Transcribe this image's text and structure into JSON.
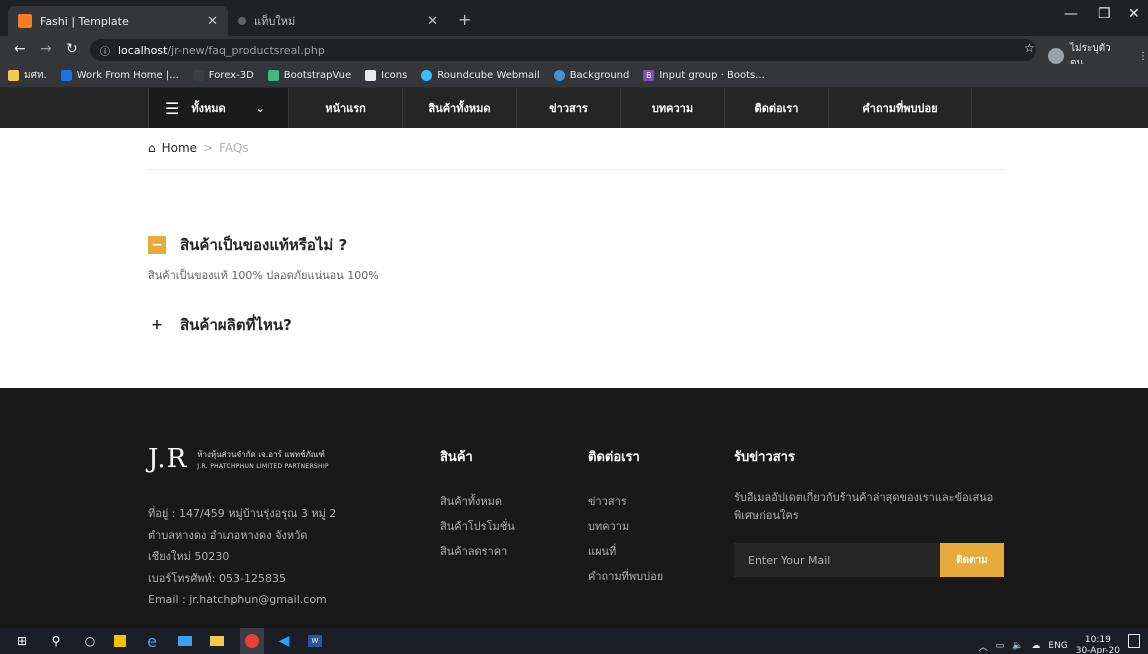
{
  "browser": {
    "tabs": [
      {
        "title": "Fashi | Template",
        "active": true
      },
      {
        "title": "แท็บใหม่",
        "active": false
      }
    ],
    "url_host": "localhost",
    "url_path": "/jr-new/faq_productsreal.php",
    "profile_label": "ไม่ระบุตัวตน",
    "bookmarks": [
      "มศท.",
      "Work From Home |...",
      "Forex-3D",
      "BootstrapVue",
      "Icons",
      "Roundcube Webmail",
      "Background",
      "Input group · Boots..."
    ]
  },
  "nav": {
    "all_label": "ทั้งหมด",
    "items": [
      "หน้าแรก",
      "สินค้าทั้งหมด",
      "ข่าวสาร",
      "บทความ",
      "ติดต่อเรา",
      "คำถามที่พบบ่อย"
    ]
  },
  "breadcrumb": {
    "home": "Home",
    "sep": ">",
    "current": "FAQs"
  },
  "faq": [
    {
      "question": "สินค้าเป็นของแท้หรือไม่ ?",
      "answer": "สินค้าเป็นของแท้ 100% ปลอดภัยแน่นอน 100%",
      "expanded": true,
      "toggle": "−"
    },
    {
      "question": "สินค้าผลิตที่ไหน?",
      "answer": "",
      "expanded": false,
      "toggle": "+"
    }
  ],
  "footer": {
    "logo_text": "J.R",
    "company_th": "ห้างหุ้นส่วนจำกัด เจ.อาร์ แพทช์ภัณฑ์",
    "company_en": "J.R. PHATCHPHUN LIMITED PARTNERSHIP",
    "address_lines": [
      "ที่อยู่ : 147/459 หมู่บ้านรุ่งอรุณ 3 หมู่ 2",
      "ตำบลหางดง อำเภอหางดง จังหวัด",
      "เชียงใหม่ 50230",
      "เบอร์โทรศัพท์: 053-125835",
      "Email : jr.hatchphun@gmail.com"
    ],
    "col_products": {
      "title": "สินค้า",
      "links": [
        "สินค้าทั้งหมด",
        "สินค้าโปรโมชั่น",
        "สินค้าลดราคา"
      ]
    },
    "col_contact": {
      "title": "ติดต่อเรา",
      "links": [
        "ข่าวสาร",
        "บทความ",
        "แผนที่",
        "คำถามที่พบบ่อย"
      ]
    },
    "newsletter": {
      "title": "รับข่าวสาร",
      "desc": "รับอีเมลอัปเดตเกี่ยวกับร้านค้าล่าสุดของเราและข้อเสนอพิเศษก่อนใคร",
      "placeholder": "Enter Your Mail",
      "button": "ติดตาม"
    }
  },
  "taskbar": {
    "lang": "ENG",
    "time": "10:19",
    "date": "30-Apr-20"
  },
  "colors": {
    "accent": "#e7ab3c",
    "nav_bg": "#252525",
    "footer_bg": "#191919"
  }
}
